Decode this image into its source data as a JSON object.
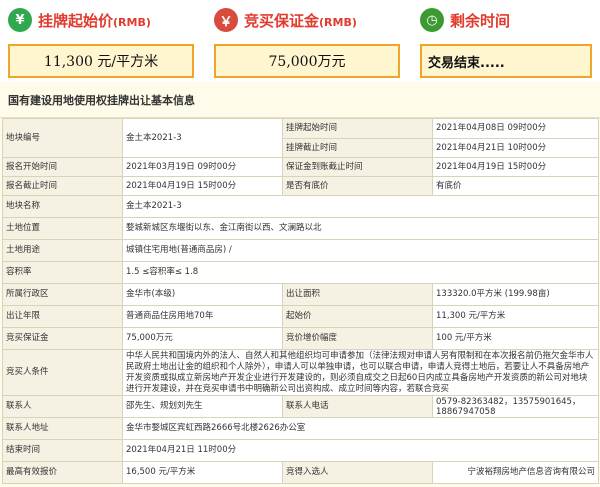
{
  "header": {
    "start_price": {
      "label": "挂牌起始价",
      "unit": "(RMB)",
      "value": "11,300 元/平方米",
      "color": "#2fa84f"
    },
    "deposit": {
      "label": "竞买保证金",
      "unit": "(RMB)",
      "value": "75,000万元",
      "color": "#d94b3d"
    },
    "time_left": {
      "label": "剩余时间",
      "value": "交易结束.....",
      "color": "#3d9a33"
    }
  },
  "section_title": "国有建设用地使用权挂牌出让基本信息",
  "rows": [
    {
      "k1": "地块编号",
      "v1": "金土本2021-3",
      "k2": "挂牌起始时间",
      "v2": "2021年04月08日 09时00分"
    },
    {
      "k1": "",
      "v1": "",
      "k2": "挂牌截止时间",
      "v2": "2021年04月21日 10时00分"
    },
    {
      "k1": "报名开始时间",
      "v1": "2021年03月19日 09时00分",
      "k2": "保证金到账截止时间",
      "v2": "2021年04月19日 15时00分"
    },
    {
      "k1": "报名截止时间",
      "v1": "2021年04月19日 15时00分",
      "k2": "是否有底价",
      "v2": "有底价"
    }
  ],
  "wide_rows": [
    {
      "k": "地块名称",
      "v": "金土本2021-3"
    },
    {
      "k": "土地位置",
      "v": "婺城新城区东堰街以东、金江南街以西、文澜路以北"
    },
    {
      "k": "土地用途",
      "v": "城镇住宅用地(普通商品房) /"
    },
    {
      "k": "容积率",
      "v": "1.5 ≤容积率≤ 1.8"
    }
  ],
  "rows2": [
    {
      "k1": "所属行政区",
      "v1": "金华市(本级)",
      "k2": "出让面积",
      "v2": "133320.0平方米 (199.98亩)"
    },
    {
      "k1": "出让年限",
      "v1": "普通商品住房用地70年",
      "k2": "起始价",
      "v2": "11,300 元/平方米"
    },
    {
      "k1": "竞买保证金",
      "v1": "75,000万元",
      "k2": "竞价增价幅度",
      "v2": "100 元/平方米"
    }
  ],
  "conditions": {
    "k": "竞买人条件",
    "v": "中华人民共和国境内外的法人、自然人和其他组织均可申请参加（法律法规对申请人另有限制和在本次报名前仍拖欠金华市人民政府土地出让金的组织和个人除外），申请人可以单独申请，也可以联合申请，申请人竞得土地后，若要让人不具备房地产开发资质或拟成立新房地产开发企业进行开发建设的，则必须自成交之日起60日内成立具备房地产开发资质的新公司对地块进行开发建设，并在竞买申请书中明确新公司出资构成、成立时间等内容，若联合竞买"
  },
  "contact": {
    "k1": "联系人",
    "v1": "邵先生、规划刘先生",
    "k2": "联系人电话",
    "v2a": "0579-82363482，13575901645，",
    "v2b": "18867947058"
  },
  "address": {
    "k": "联系人地址",
    "v": "金华市婺城区宾虹西路2666号北楼2626办公室"
  },
  "end_time": {
    "k": "结束时间",
    "v": "2021年04月21日 11时00分"
  },
  "final": {
    "k1": "最高有效报价",
    "v1": "16,500 元/平方米",
    "k2": "竞得入选人",
    "v2": "宁波裕翔房地产信息咨询有限公司"
  }
}
